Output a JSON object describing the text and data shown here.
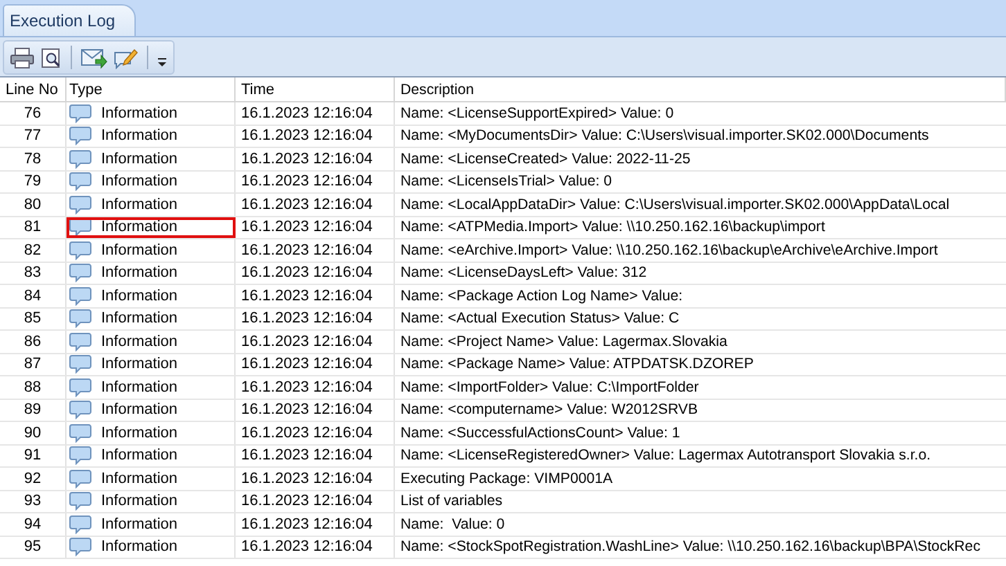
{
  "tabs": [
    {
      "label": "Execution Log",
      "selected": true
    }
  ],
  "table": {
    "columns": [
      "Line No",
      "Type",
      "Time",
      "Description"
    ],
    "rows": [
      {
        "line": "76",
        "type": "Information",
        "time": "16.1.2023 12:16:04",
        "description": "Name: <LicenseSupportExpired> Value: 0",
        "highlighted": false
      },
      {
        "line": "77",
        "type": "Information",
        "time": "16.1.2023 12:16:04",
        "description": "Name: <MyDocumentsDir> Value: C:\\Users\\visual.importer.SK02.000\\Documents",
        "highlighted": false
      },
      {
        "line": "78",
        "type": "Information",
        "time": "16.1.2023 12:16:04",
        "description": "Name: <LicenseCreated> Value: 2022-11-25",
        "highlighted": false
      },
      {
        "line": "79",
        "type": "Information",
        "time": "16.1.2023 12:16:04",
        "description": "Name: <LicenseIsTrial> Value: 0",
        "highlighted": false
      },
      {
        "line": "80",
        "type": "Information",
        "time": "16.1.2023 12:16:04",
        "description": "Name: <LocalAppDataDir> Value: C:\\Users\\visual.importer.SK02.000\\AppData\\Local",
        "highlighted": false
      },
      {
        "line": "81",
        "type": "Information",
        "time": "16.1.2023 12:16:04",
        "description": "Name: <ATPMedia.Import> Value: \\\\10.250.162.16\\backup\\import",
        "highlighted": true
      },
      {
        "line": "82",
        "type": "Information",
        "time": "16.1.2023 12:16:04",
        "description": "Name: <eArchive.Import> Value: \\\\10.250.162.16\\backup\\eArchive\\eArchive.Import",
        "highlighted": false
      },
      {
        "line": "83",
        "type": "Information",
        "time": "16.1.2023 12:16:04",
        "description": "Name: <LicenseDaysLeft> Value: 312",
        "highlighted": false
      },
      {
        "line": "84",
        "type": "Information",
        "time": "16.1.2023 12:16:04",
        "description": "Name: <Package Action Log Name> Value:",
        "highlighted": false
      },
      {
        "line": "85",
        "type": "Information",
        "time": "16.1.2023 12:16:04",
        "description": "Name: <Actual Execution Status> Value: C",
        "highlighted": false
      },
      {
        "line": "86",
        "type": "Information",
        "time": "16.1.2023 12:16:04",
        "description": "Name: <Project Name> Value: Lagermax.Slovakia",
        "highlighted": false
      },
      {
        "line": "87",
        "type": "Information",
        "time": "16.1.2023 12:16:04",
        "description": "Name: <Package Name> Value: ATPDATSK.DZOREP",
        "highlighted": false
      },
      {
        "line": "88",
        "type": "Information",
        "time": "16.1.2023 12:16:04",
        "description": "Name: <ImportFolder> Value: C:\\ImportFolder",
        "highlighted": false
      },
      {
        "line": "89",
        "type": "Information",
        "time": "16.1.2023 12:16:04",
        "description": "Name: <computername> Value: W2012SRVB",
        "highlighted": false
      },
      {
        "line": "90",
        "type": "Information",
        "time": "16.1.2023 12:16:04",
        "description": "Name: <SuccessfulActionsCount> Value: 1",
        "highlighted": false
      },
      {
        "line": "91",
        "type": "Information",
        "time": "16.1.2023 12:16:04",
        "description": "Name: <LicenseRegisteredOwner> Value: Lagermax Autotransport Slovakia s.r.o.",
        "highlighted": false
      },
      {
        "line": "92",
        "type": "Information",
        "time": "16.1.2023 12:16:04",
        "description": "Executing Package: VIMP0001A",
        "highlighted": false
      },
      {
        "line": "93",
        "type": "Information",
        "time": "16.1.2023 12:16:04",
        "description": "List of variables",
        "highlighted": false
      },
      {
        "line": "94",
        "type": "Information",
        "time": "16.1.2023 12:16:04",
        "description": "Name:  Value: 0",
        "highlighted": false
      },
      {
        "line": "95",
        "type": "Information",
        "time": "16.1.2023 12:16:04",
        "description": "Name: <StockSpotRegistration.WashLine> Value: \\\\10.250.162.16\\backup\\BPA\\StockRec",
        "highlighted": false
      }
    ]
  }
}
